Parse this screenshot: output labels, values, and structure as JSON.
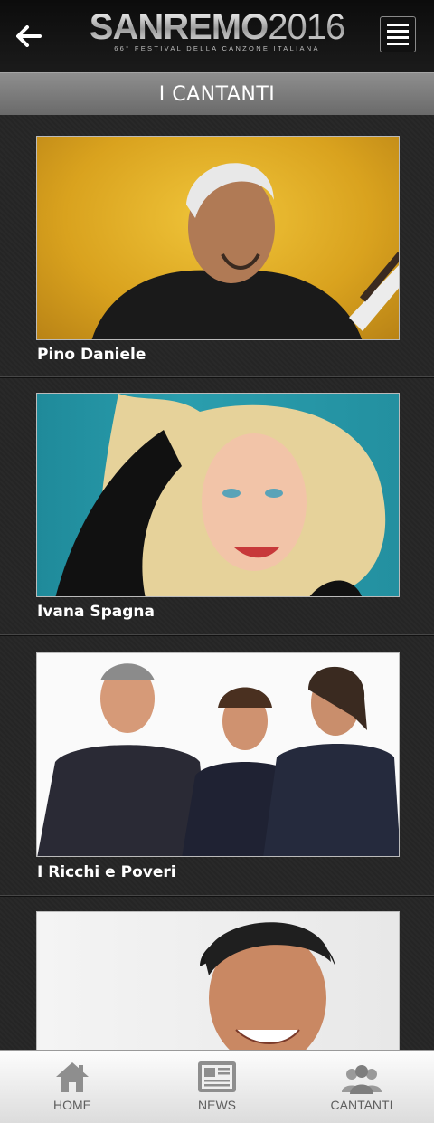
{
  "header": {
    "logo_text": "SANREMO",
    "logo_year": "2016",
    "logo_subtitle": "66° FESTIVAL DELLA CANZONE ITALIANA",
    "back_icon": "arrow-left-icon",
    "menu_icon": "hamburger-menu-icon"
  },
  "page": {
    "title": "I CANTANTI"
  },
  "singers": [
    {
      "name": "Pino Daniele"
    },
    {
      "name": "Ivana Spagna"
    },
    {
      "name": "I Ricchi e Poveri"
    },
    {
      "name": ""
    }
  ],
  "tabbar": {
    "tabs": [
      {
        "label": "HOME",
        "icon": "home-icon"
      },
      {
        "label": "NEWS",
        "icon": "newspaper-icon"
      },
      {
        "label": "CANTANTI",
        "icon": "people-icon"
      }
    ]
  },
  "colors": {
    "background": "#262626",
    "title_bar": "#7a7a7a",
    "text": "#ffffff",
    "tab_label": "#5e5e5e"
  }
}
